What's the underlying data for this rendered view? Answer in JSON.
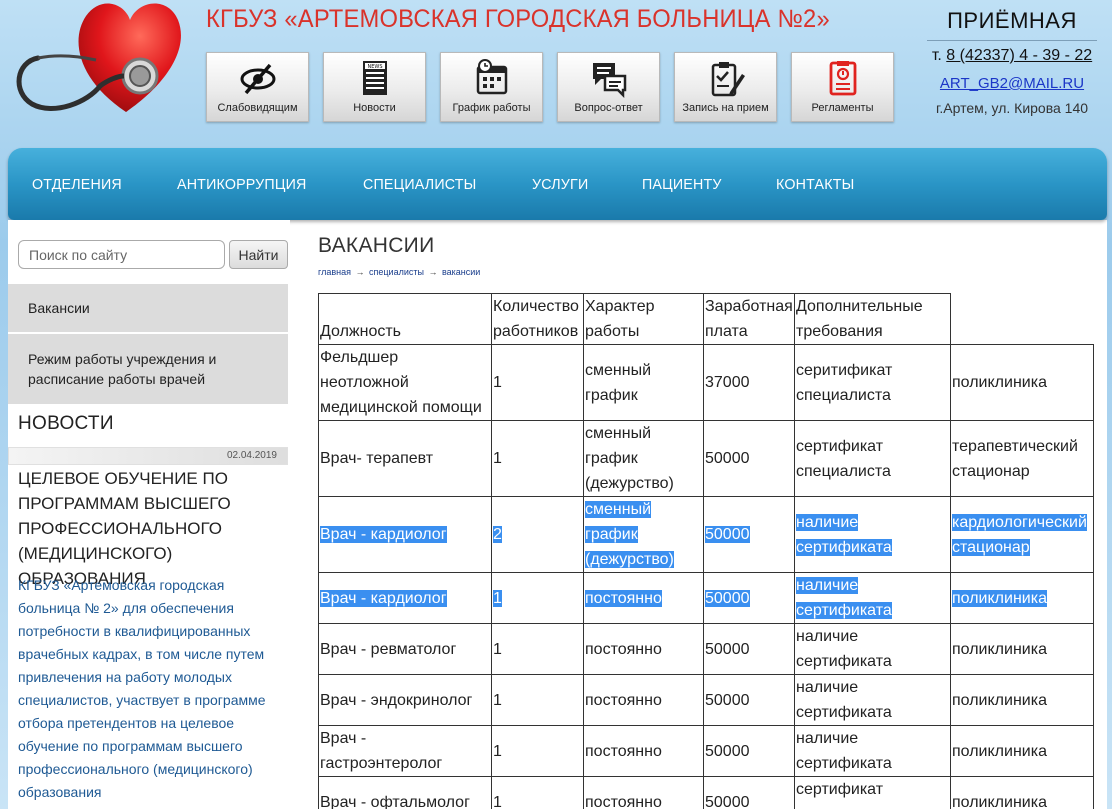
{
  "header": {
    "site_title": "КГБУЗ «АРТЕМОВСКАЯ ГОРОДСКАЯ БОЛЬНИЦА №2»",
    "icons": [
      {
        "label": "Слабовидящим",
        "icon": "eye-slash-icon"
      },
      {
        "label": "Новости",
        "icon": "newspaper-icon"
      },
      {
        "label": "График работы",
        "icon": "calendar-clock-icon"
      },
      {
        "label": "Вопрос-ответ",
        "icon": "chat-bubbles-icon"
      },
      {
        "label": "Запись на прием",
        "icon": "clipboard-check-icon"
      },
      {
        "label": "Регламенты",
        "icon": "document-alert-icon"
      }
    ],
    "reception": {
      "title": "ПРИЁМНАЯ",
      "phone_prefix": "т.",
      "phone": "8 (42337) 4 - 39 - 22",
      "email": "ART_GB2@MAIL.RU",
      "address": "г.Артем, ул. Кирова 140"
    }
  },
  "nav": [
    "ОТДЕЛЕНИЯ",
    "АНТИКОРРУПЦИЯ",
    "СПЕЦИАЛИСТЫ",
    "УСЛУГИ",
    "ПАЦИЕНТУ",
    "КОНТАКТЫ"
  ],
  "sidebar": {
    "search_placeholder": "Поиск по сайту",
    "search_button": "Найти",
    "menu": [
      "Вакансии",
      "Режим работы учреждения и расписание работы врачей"
    ],
    "news_heading": "НОВОСТИ",
    "news_date": "02.04.2019",
    "news_title": "ЦЕЛЕВОЕ ОБУЧЕНИЕ ПО ПРОГРАММАМ ВЫСШЕГО ПРОФЕССИОНАЛЬНОГО (МЕДИЦИНСКОГО) ОБРАЗОВАНИЯ",
    "news_text": "КГБУЗ «Артемовская городская больница № 2» для обеспечения потребности в квалифицированных врачебных кадрах, в том числе путем привлечения на работу молодых специалистов, участвует в программе отбора претендентов на целевое обучение по программам высшего профессионального (медицинского) образования"
  },
  "main": {
    "title": "ВАКАНСИИ",
    "breadcrumb": [
      "главная",
      "специалисты",
      "вакансии"
    ],
    "breadcrumb_sep": "→",
    "table": {
      "headers": [
        "Должность",
        "Количество работников",
        "Характер работы",
        "Заработная плата",
        "Дополнительные требования"
      ],
      "rows": [
        {
          "cells": [
            "Фельдшер неотложной медицинской помощи",
            "1",
            "сменный график",
            "37000",
            "серитификат специалиста",
            " поликлиника"
          ],
          "selected": false
        },
        {
          "cells": [
            "Врач- терапевт",
            "1",
            "сменный график (дежурство)",
            "50000",
            "сертификат специалиста",
            " терапевтический стационар"
          ],
          "selected": false
        },
        {
          "cells": [
            "Врач - кардиолог",
            "2",
            "сменный график (дежурство)",
            "50000",
            "наличие сертификата",
            " кардиологический стационар"
          ],
          "selected": true
        },
        {
          "cells": [
            "Врач - кардиолог",
            "1",
            "постоянно",
            "50000",
            "наличие сертификата",
            " поликлиника"
          ],
          "selected": true
        },
        {
          "cells": [
            "Врач - ревматолог",
            "1",
            "постоянно",
            "50000",
            "наличие сертификата",
            " поликлиника"
          ],
          "selected": false
        },
        {
          "cells": [
            "Врач - эндокринолог",
            "1",
            "постоянно",
            "50000",
            "наличие сертификата",
            " поликлиника"
          ],
          "selected": false
        },
        {
          "cells": [
            "Врач - гастроэнтеролог",
            "1",
            "постоянно",
            "50000",
            "наличие сертификата",
            " поликлиника"
          ],
          "selected": false
        },
        {
          "cells": [
            "Врач - офтальмолог",
            "1",
            "постоянно",
            "50000",
            "сертификат специалиста",
            " поликлиника"
          ],
          "selected": false
        }
      ]
    }
  }
}
